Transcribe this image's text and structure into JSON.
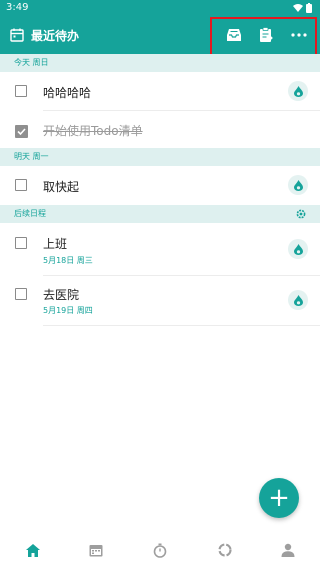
{
  "status_bar": {
    "time": "3:49"
  },
  "app_bar": {
    "title": "最近待办",
    "icons": [
      "calendar-icon",
      "inbox-icon",
      "clipboard-icon",
      "more-icon"
    ]
  },
  "sections": [
    {
      "label": "今天  周日"
    },
    {
      "label": "明天  周一"
    },
    {
      "label": "后续日程",
      "icon": "gear-icon"
    }
  ],
  "tasks": [
    {
      "text": "哈哈哈哈",
      "done": false
    },
    {
      "text": "开始使用Todo清单",
      "done": true
    },
    {
      "text": "取快起",
      "done": false
    },
    {
      "text": "上班",
      "sub": "5月18日 周三",
      "done": false
    },
    {
      "text": "去医院",
      "sub": "5月19日 周四",
      "done": false
    }
  ],
  "fab": {
    "label": "+"
  },
  "bottom_nav": [
    "home-icon",
    "calendar-icon",
    "timer-icon",
    "stats-icon",
    "profile-icon"
  ],
  "colors": {
    "accent": "#15a39a",
    "section_bg": "#def0ef",
    "highlight_box": "#e5191f"
  }
}
